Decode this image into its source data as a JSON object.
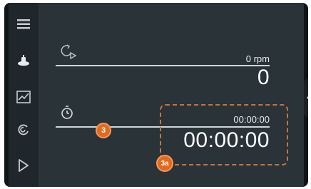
{
  "speed": {
    "setpoint": "0 rpm",
    "value": "0"
  },
  "timer": {
    "setpoint": "00:00:00",
    "value": "00:00:00"
  },
  "callouts": {
    "timer_line": "3",
    "timer_box": "3a"
  },
  "colors": {
    "accent": "#e2691f",
    "panel": "#2a3338",
    "sidebar": "#20272c"
  },
  "icons": {
    "sidebar": [
      "menu-icon",
      "stirrer-icon",
      "chart-icon",
      "cycle-icon",
      "play-icon"
    ],
    "speed": "rotation-play-icon",
    "timer": "stopwatch-icon",
    "side_tab": "chevron-left-icon"
  }
}
